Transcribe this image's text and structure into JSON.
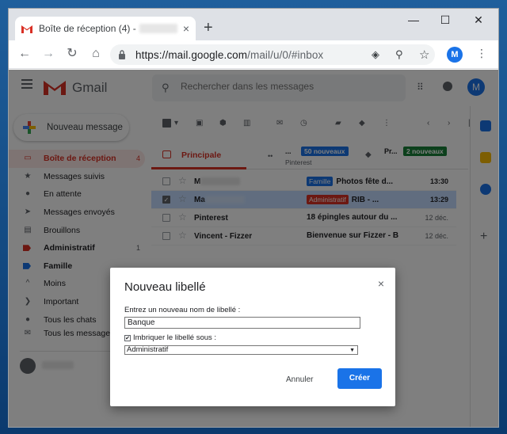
{
  "browser": {
    "tab_title": "Boîte de réception (4) -",
    "tab_close": "×",
    "new_tab": "+",
    "window_controls": {
      "minimize": "—",
      "maximize": "☐",
      "close": "✕"
    },
    "nav": {
      "back": "←",
      "forward": "→",
      "reload": "↻",
      "home": "⌂"
    },
    "url_host": "https://mail.google.com",
    "url_path": "/mail/u/0/#inbox",
    "omni_icons": [
      "◈",
      "⚲",
      "☆"
    ],
    "profile_initial": "M",
    "menu": "⋮"
  },
  "gmail": {
    "brand": "Gmail",
    "search_placeholder": "Rechercher dans les messages",
    "avatar_initial": "M",
    "compose_label": "Nouveau message",
    "sidebar": [
      {
        "label": "Boîte de réception",
        "icon": "inbox-icon",
        "count": "4",
        "active": true
      },
      {
        "label": "Messages suivis",
        "icon": "star-icon"
      },
      {
        "label": "En attente",
        "icon": "clock-icon"
      },
      {
        "label": "Messages envoyés",
        "icon": "send-icon"
      },
      {
        "label": "Brouillons",
        "icon": "draft-icon"
      },
      {
        "label": "Administratif",
        "icon": "label-icon",
        "count": "1",
        "color": "#d93025"
      },
      {
        "label": "Famille",
        "icon": "label-icon",
        "color": "#1a73e8"
      },
      {
        "label": "Moins",
        "icon": "chevron-up-icon"
      },
      {
        "label": "Important",
        "icon": "important-icon"
      },
      {
        "label": "Tous les chats",
        "icon": "chat-icon"
      },
      {
        "label": "Tous les messages",
        "icon": "mail-icon"
      }
    ],
    "categories": {
      "primary": "Principale",
      "social_name": "...",
      "social_sub": "Pinterest",
      "social_badge": "50 nouveaux",
      "promo_name": "Pr...",
      "promo_badge": "2 nouveaux"
    },
    "emails": [
      {
        "sender": "M",
        "tag": "Famille",
        "tag_color": "#1a73e8",
        "subject": "Photos fête d...",
        "date": "13:30",
        "selected": false
      },
      {
        "sender": "Ma",
        "tag": "Administratif",
        "tag_color": "#d93025",
        "subject": "RIB - ...",
        "date": "13:29",
        "selected": true
      },
      {
        "sender": "Pinterest",
        "tag": "",
        "subject": "18 épingles autour du ...",
        "date": "12 déc.",
        "selected": false
      },
      {
        "sender": "Vincent - Fizzer",
        "tag": "",
        "subject": "Bienvenue sur Fizzer - B",
        "date": "12 déc.",
        "selected": false
      }
    ]
  },
  "dialog": {
    "title": "Nouveau libellé",
    "name_label": "Entrez un nouveau nom de libellé :",
    "name_value": "Banque",
    "nest_label": "Imbriquer le libellé sous :",
    "nest_checked": "✔",
    "parent_value": "Administratif",
    "close": "×",
    "cancel": "Annuler",
    "create": "Créer"
  },
  "colors": {
    "accent": "#1a73e8",
    "red": "#d93025",
    "selected_row": "#c2dbff"
  }
}
